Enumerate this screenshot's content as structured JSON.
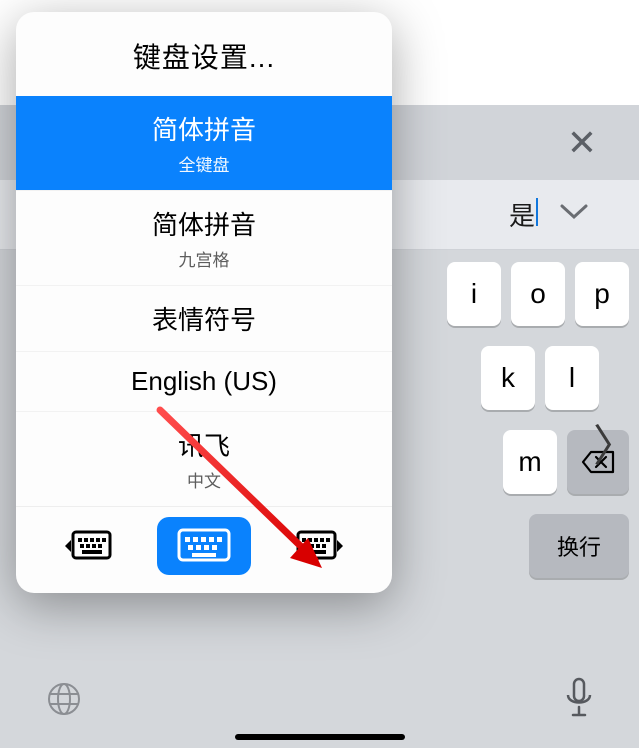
{
  "popover": {
    "header": "键盘设置...",
    "items": [
      {
        "title": "简体拼音",
        "subtitle": "全键盘",
        "selected": true
      },
      {
        "title": "简体拼音",
        "subtitle": "九宫格",
        "selected": false
      },
      {
        "title": "表情符号",
        "subtitle": "",
        "selected": false
      },
      {
        "title": "English (US)",
        "subtitle": "",
        "selected": false
      },
      {
        "title": "讯飞",
        "subtitle": "中文",
        "selected": false
      }
    ]
  },
  "suggestion": {
    "text": "是"
  },
  "keys": {
    "row1": [
      "i",
      "o",
      "p"
    ],
    "row2": [
      "k",
      "l"
    ],
    "row3_left": "m",
    "row4_action": "换行"
  },
  "icons": {
    "dictation": "🎤",
    "globe": "🌐"
  }
}
